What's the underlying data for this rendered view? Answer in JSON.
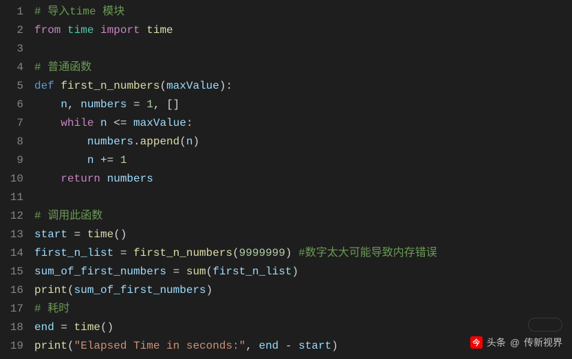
{
  "gutter": [
    "1",
    "2",
    "3",
    "4",
    "5",
    "6",
    "7",
    "8",
    "9",
    "10",
    "11",
    "12",
    "13",
    "14",
    "15",
    "16",
    "17",
    "18",
    "19"
  ],
  "code": {
    "l1": {
      "c1": "# 导入time 模块"
    },
    "l2": {
      "kw": "from",
      "mod": "time",
      "kw2": "import",
      "name": "time"
    },
    "l3": {},
    "l4": {
      "c1": "# 普通函数"
    },
    "l5": {
      "kw": "def",
      "fn": "first_n_numbers",
      "p1": "(",
      "arg": "maxValue",
      "p2": "):"
    },
    "l6": {
      "v1": "n",
      "p1": ", ",
      "v2": "numbers",
      "op": " = ",
      "n1": "1",
      "p2": ", []"
    },
    "l7": {
      "kw": "while",
      "v1": "n",
      "op": " <= ",
      "v2": "maxValue",
      "p1": ":"
    },
    "l8": {
      "v1": "numbers",
      "p1": ".",
      "fn": "append",
      "p2": "(",
      "v2": "n",
      "p3": ")"
    },
    "l9": {
      "v1": "n",
      "op": " += ",
      "n1": "1"
    },
    "l10": {
      "kw": "return",
      "v1": "numbers"
    },
    "l11": {},
    "l12": {
      "c1": "# 调用此函数"
    },
    "l13": {
      "v1": "start",
      "op": " = ",
      "fn": "time",
      "p1": "()"
    },
    "l14": {
      "v1": "first_n_list",
      "op": " = ",
      "fn": "first_n_numbers",
      "p1": "(",
      "n1": "9999999",
      "p2": ") ",
      "c1": "#数字太大可能导致内存错误"
    },
    "l15": {
      "v1": "sum_of_first_numbers",
      "op": " = ",
      "fn": "sum",
      "p1": "(",
      "v2": "first_n_list",
      "p2": ")"
    },
    "l16": {
      "fn": "print",
      "p1": "(",
      "v1": "sum_of_first_numbers",
      "p2": ")"
    },
    "l17": {
      "c1": "# 耗时"
    },
    "l18": {
      "v1": "end",
      "op": " = ",
      "fn": "time",
      "p1": "()"
    },
    "l19": {
      "fn": "print",
      "p1": "(",
      "s1": "\"Elapsed Time in seconds:\"",
      "p2": ", ",
      "v1": "end",
      "op": " - ",
      "v2": "start",
      "p3": ")"
    }
  },
  "watermark": {
    "prefix": "头条",
    "at": "@",
    "name": "传新视界",
    "logo": "今"
  }
}
